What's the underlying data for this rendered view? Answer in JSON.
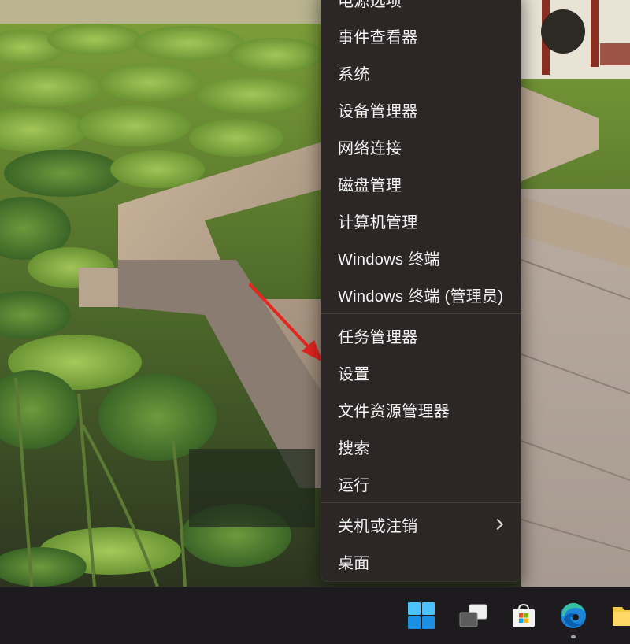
{
  "context_menu": {
    "items": [
      {
        "label": "电源选项",
        "name": "menu-item-power-options"
      },
      {
        "label": "事件查看器",
        "name": "menu-item-event-viewer"
      },
      {
        "label": "系统",
        "name": "menu-item-system"
      },
      {
        "label": "设备管理器",
        "name": "menu-item-device-manager"
      },
      {
        "label": "网络连接",
        "name": "menu-item-network-connections"
      },
      {
        "label": "磁盘管理",
        "name": "menu-item-disk-management"
      },
      {
        "label": "计算机管理",
        "name": "menu-item-computer-management"
      },
      {
        "label": "Windows 终端",
        "name": "menu-item-windows-terminal"
      },
      {
        "label": "Windows 终端 (管理员)",
        "name": "menu-item-windows-terminal-admin"
      },
      {
        "label": "任务管理器",
        "name": "menu-item-task-manager"
      },
      {
        "label": "设置",
        "name": "menu-item-settings"
      },
      {
        "label": "文件资源管理器",
        "name": "menu-item-file-explorer"
      },
      {
        "label": "搜索",
        "name": "menu-item-search"
      },
      {
        "label": "运行",
        "name": "menu-item-run"
      },
      {
        "label": "关机或注销",
        "name": "menu-item-shutdown-signout",
        "has_submenu": true
      },
      {
        "label": "桌面",
        "name": "menu-item-desktop"
      }
    ]
  },
  "taskbar": {
    "icons": [
      "windows-start-icon",
      "task-view-icon",
      "microsoft-store-icon",
      "edge-browser-icon",
      "file-explorer-icon"
    ]
  },
  "annotation": {
    "arrow_color": "#e5251f",
    "points_to": "设置"
  },
  "colors": {
    "menu_bg": "#2c2726",
    "menu_text": "#f2f2f2",
    "taskbar_bg": "#1d1b1e",
    "accent": "#3a9be8"
  }
}
